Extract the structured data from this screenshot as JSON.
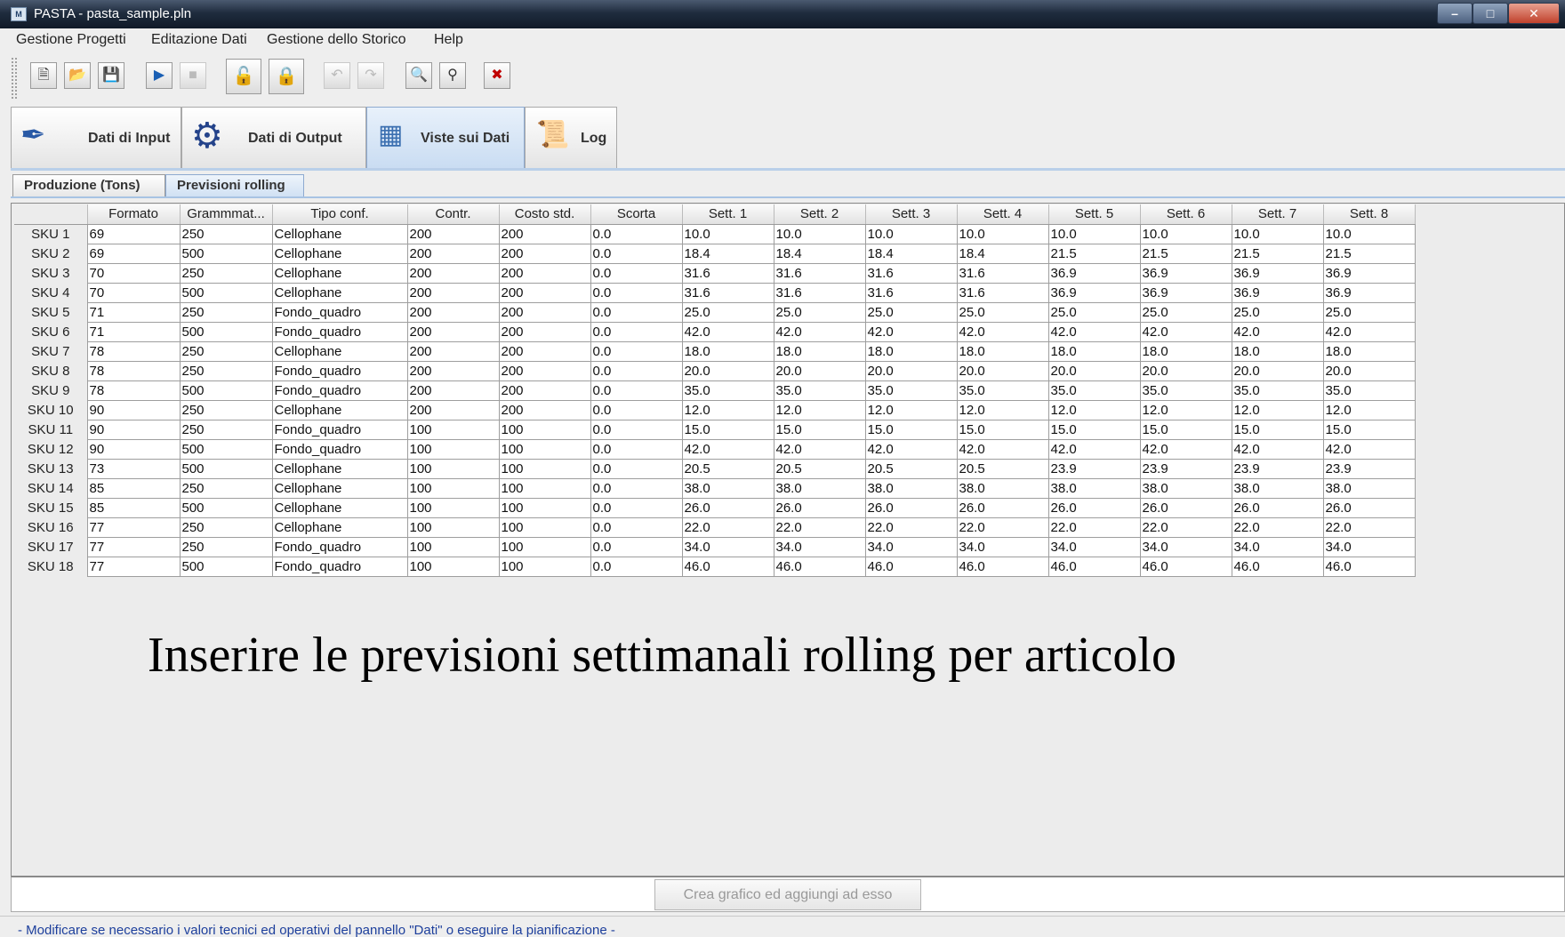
{
  "window": {
    "title": "PASTA - pasta_sample.pln",
    "icon": "pasta-app-icon"
  },
  "menu": [
    "Gestione Progetti",
    "Editazione Dati",
    "Gestione dello Storico",
    "Help"
  ],
  "toolbar": {
    "icons": [
      "new-project-icon",
      "open-folder-icon",
      "save-icon",
      "run-icon",
      "stop-icon",
      "unlock-db-icon",
      "lock-db-icon",
      "undo-icon",
      "redo-icon",
      "zoom-page-icon",
      "search-icon",
      "close-x-icon"
    ]
  },
  "main_tabs": [
    {
      "label": "Dati di Input",
      "icon": "pen-icon"
    },
    {
      "label": "Dati di Output",
      "icon": "gear-icon"
    },
    {
      "label": "Viste sui Dati",
      "icon": "table-icon",
      "active": true
    },
    {
      "label": "Log",
      "icon": "scroll-icon"
    }
  ],
  "sub_tabs": [
    {
      "label": "Produzione (Tons)"
    },
    {
      "label": "Previsioni rolling",
      "active": true
    }
  ],
  "table": {
    "headers": [
      "Formato",
      "Grammmat...",
      "Tipo conf.",
      "Contr.",
      "Costo std.",
      "Scorta",
      "Sett. 1",
      "Sett. 2",
      "Sett. 3",
      "Sett. 4",
      "Sett. 5",
      "Sett. 6",
      "Sett. 7",
      "Sett. 8"
    ],
    "rows": [
      {
        "label": "SKU 1",
        "cells": [
          "69",
          "250",
          "Cellophane",
          "200",
          "200",
          "0.0",
          "10.0",
          "10.0",
          "10.0",
          "10.0",
          "10.0",
          "10.0",
          "10.0",
          "10.0"
        ]
      },
      {
        "label": "SKU 2",
        "cells": [
          "69",
          "500",
          "Cellophane",
          "200",
          "200",
          "0.0",
          "18.4",
          "18.4",
          "18.4",
          "18.4",
          "21.5",
          "21.5",
          "21.5",
          "21.5"
        ]
      },
      {
        "label": "SKU 3",
        "cells": [
          "70",
          "250",
          "Cellophane",
          "200",
          "200",
          "0.0",
          "31.6",
          "31.6",
          "31.6",
          "31.6",
          "36.9",
          "36.9",
          "36.9",
          "36.9"
        ]
      },
      {
        "label": "SKU 4",
        "cells": [
          "70",
          "500",
          "Cellophane",
          "200",
          "200",
          "0.0",
          "31.6",
          "31.6",
          "31.6",
          "31.6",
          "36.9",
          "36.9",
          "36.9",
          "36.9"
        ]
      },
      {
        "label": "SKU 5",
        "cells": [
          "71",
          "250",
          "Fondo_quadro",
          "200",
          "200",
          "0.0",
          "25.0",
          "25.0",
          "25.0",
          "25.0",
          "25.0",
          "25.0",
          "25.0",
          "25.0"
        ]
      },
      {
        "label": "SKU 6",
        "cells": [
          "71",
          "500",
          "Fondo_quadro",
          "200",
          "200",
          "0.0",
          "42.0",
          "42.0",
          "42.0",
          "42.0",
          "42.0",
          "42.0",
          "42.0",
          "42.0"
        ]
      },
      {
        "label": "SKU 7",
        "cells": [
          "78",
          "250",
          "Cellophane",
          "200",
          "200",
          "0.0",
          "18.0",
          "18.0",
          "18.0",
          "18.0",
          "18.0",
          "18.0",
          "18.0",
          "18.0"
        ]
      },
      {
        "label": "SKU 8",
        "cells": [
          "78",
          "250",
          "Fondo_quadro",
          "200",
          "200",
          "0.0",
          "20.0",
          "20.0",
          "20.0",
          "20.0",
          "20.0",
          "20.0",
          "20.0",
          "20.0"
        ]
      },
      {
        "label": "SKU 9",
        "cells": [
          "78",
          "500",
          "Fondo_quadro",
          "200",
          "200",
          "0.0",
          "35.0",
          "35.0",
          "35.0",
          "35.0",
          "35.0",
          "35.0",
          "35.0",
          "35.0"
        ]
      },
      {
        "label": "SKU 10",
        "cells": [
          "90",
          "250",
          "Cellophane",
          "200",
          "200",
          "0.0",
          "12.0",
          "12.0",
          "12.0",
          "12.0",
          "12.0",
          "12.0",
          "12.0",
          "12.0"
        ]
      },
      {
        "label": "SKU 11",
        "cells": [
          "90",
          "250",
          "Fondo_quadro",
          "100",
          "100",
          "0.0",
          "15.0",
          "15.0",
          "15.0",
          "15.0",
          "15.0",
          "15.0",
          "15.0",
          "15.0"
        ]
      },
      {
        "label": "SKU 12",
        "cells": [
          "90",
          "500",
          "Fondo_quadro",
          "100",
          "100",
          "0.0",
          "42.0",
          "42.0",
          "42.0",
          "42.0",
          "42.0",
          "42.0",
          "42.0",
          "42.0"
        ]
      },
      {
        "label": "SKU 13",
        "cells": [
          "73",
          "500",
          "Cellophane",
          "100",
          "100",
          "0.0",
          "20.5",
          "20.5",
          "20.5",
          "20.5",
          "23.9",
          "23.9",
          "23.9",
          "23.9"
        ]
      },
      {
        "label": "SKU 14",
        "cells": [
          "85",
          "250",
          "Cellophane",
          "100",
          "100",
          "0.0",
          "38.0",
          "38.0",
          "38.0",
          "38.0",
          "38.0",
          "38.0",
          "38.0",
          "38.0"
        ]
      },
      {
        "label": "SKU 15",
        "cells": [
          "85",
          "500",
          "Cellophane",
          "100",
          "100",
          "0.0",
          "26.0",
          "26.0",
          "26.0",
          "26.0",
          "26.0",
          "26.0",
          "26.0",
          "26.0"
        ]
      },
      {
        "label": "SKU 16",
        "cells": [
          "77",
          "250",
          "Cellophane",
          "100",
          "100",
          "0.0",
          "22.0",
          "22.0",
          "22.0",
          "22.0",
          "22.0",
          "22.0",
          "22.0",
          "22.0"
        ]
      },
      {
        "label": "SKU 17",
        "cells": [
          "77",
          "250",
          "Fondo_quadro",
          "100",
          "100",
          "0.0",
          "34.0",
          "34.0",
          "34.0",
          "34.0",
          "34.0",
          "34.0",
          "34.0",
          "34.0"
        ]
      },
      {
        "label": "SKU 18",
        "cells": [
          "77",
          "500",
          "Fondo_quadro",
          "100",
          "100",
          "0.0",
          "46.0",
          "46.0",
          "46.0",
          "46.0",
          "46.0",
          "46.0",
          "46.0",
          "46.0"
        ]
      }
    ]
  },
  "overlay_text": "Inserire le previsioni settimanali rolling per articolo",
  "chart_button_label": "Crea grafico ed aggiungi ad esso",
  "status_text": "- Modificare se necessario i valori tecnici ed operativi del pannello \"Dati\" o eseguire la pianificazione -"
}
